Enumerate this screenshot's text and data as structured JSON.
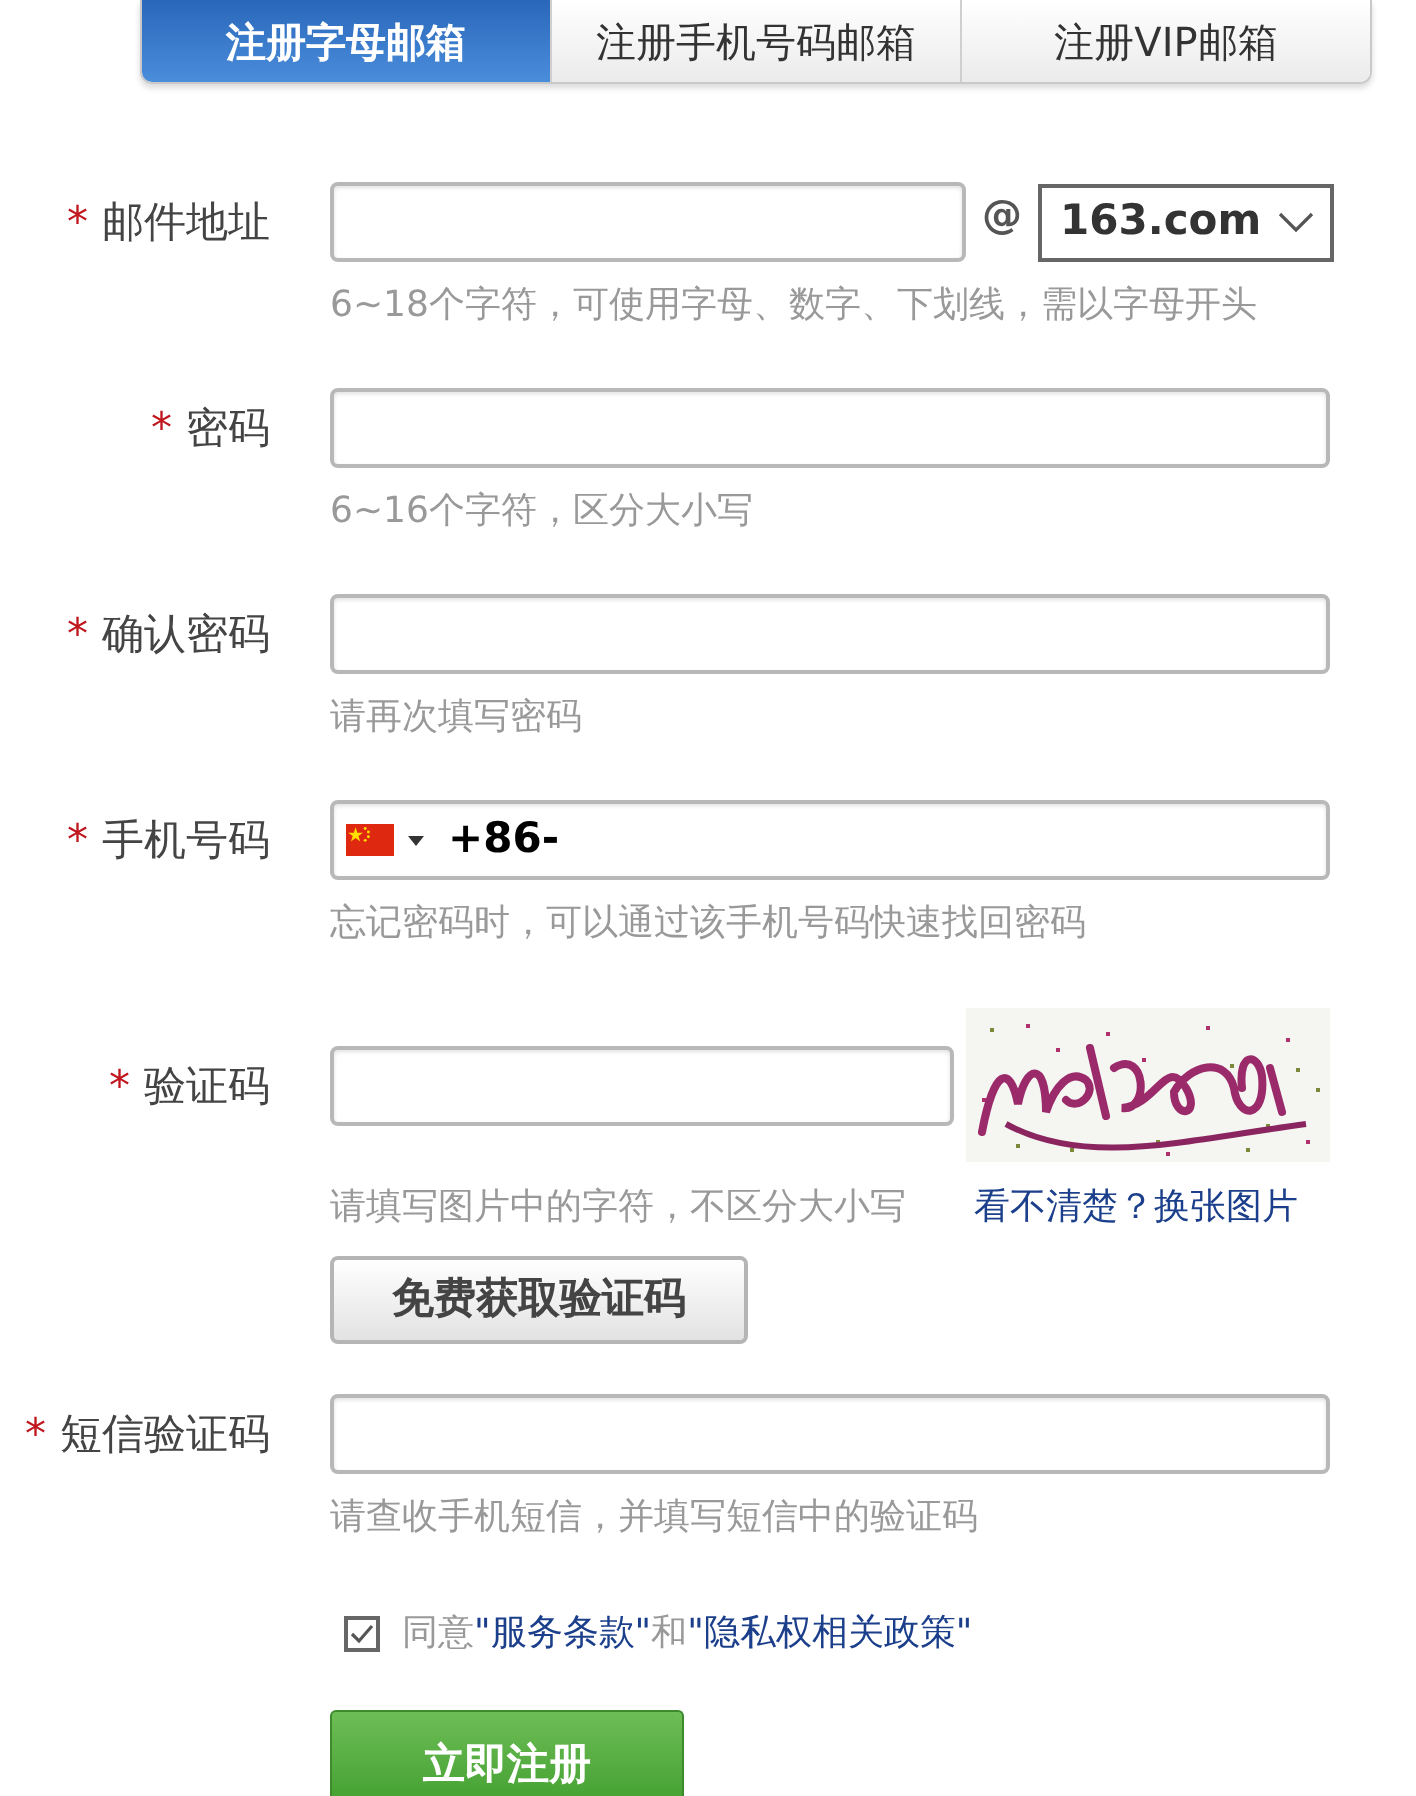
{
  "tabs": [
    {
      "label": "注册字母邮箱",
      "selected": true
    },
    {
      "label": "注册手机号码邮箱",
      "selected": false
    },
    {
      "label": "注册VIP邮箱",
      "selected": false
    }
  ],
  "fields": [
    {
      "kind": "email",
      "mark": "*",
      "label": "邮件地址",
      "at": "@",
      "domain": "163.com",
      "hint": "6~18个字符，可使用字母、数字、下划线，需以字母开头"
    },
    {
      "kind": "password",
      "mark": "*",
      "label": "密码",
      "hint": "6~16个字符，区分大小写"
    },
    {
      "kind": "password",
      "mark": "*",
      "label": "确认密码",
      "hint": "请再次填写密码"
    },
    {
      "kind": "phone",
      "mark": "*",
      "label": "手机号码",
      "prefix": "+86-",
      "hint": "忘记密码时，可以通过该手机号码快速找回密码"
    },
    {
      "kind": "captcha",
      "mark": "*",
      "label": "验证码",
      "hint": "请填写图片中的字符，不区分大小写",
      "link": "看不清楚？换张图片",
      "button": "免费获取验证码"
    },
    {
      "kind": "text",
      "mark": "*",
      "label": "短信验证码",
      "hint": "请查收手机短信，并填写短信中的验证码"
    }
  ],
  "agreement": {
    "checked": true,
    "parts": [
      {
        "text": "同意",
        "link": false
      },
      {
        "text": "\"服务条款\"",
        "link": true
      },
      {
        "text": "和",
        "link": false
      },
      {
        "text": "\"隐私权相关政策\"",
        "link": true
      }
    ]
  },
  "submit": "立即注册"
}
